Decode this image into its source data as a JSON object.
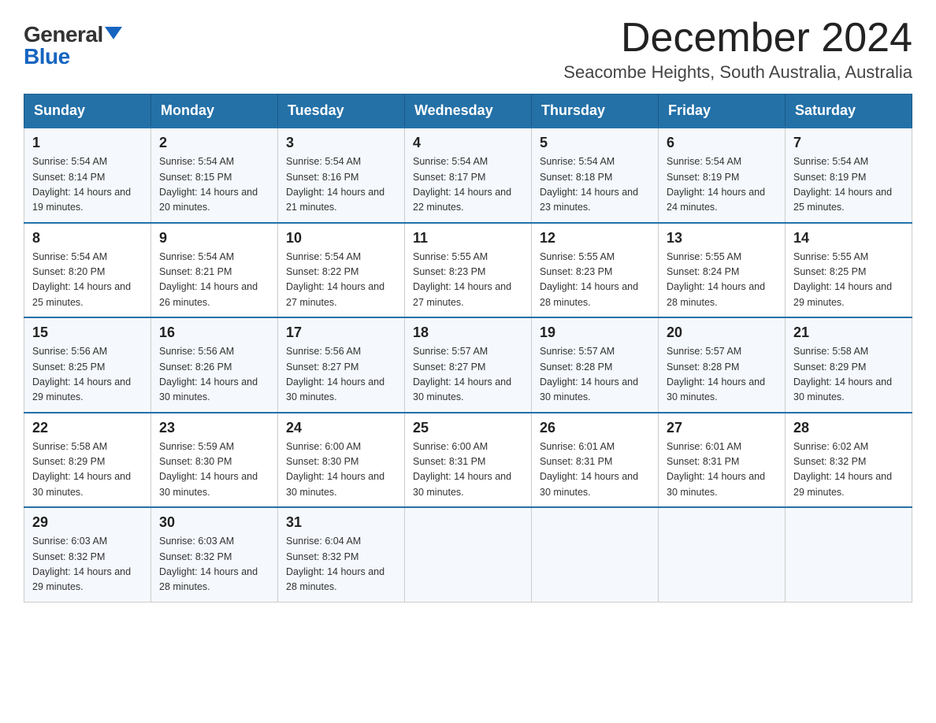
{
  "logo": {
    "general": "General",
    "blue": "Blue"
  },
  "title": {
    "month_year": "December 2024",
    "location": "Seacombe Heights, South Australia, Australia"
  },
  "headers": [
    "Sunday",
    "Monday",
    "Tuesday",
    "Wednesday",
    "Thursday",
    "Friday",
    "Saturday"
  ],
  "weeks": [
    [
      {
        "day": "1",
        "sunrise": "5:54 AM",
        "sunset": "8:14 PM",
        "daylight": "14 hours and 19 minutes."
      },
      {
        "day": "2",
        "sunrise": "5:54 AM",
        "sunset": "8:15 PM",
        "daylight": "14 hours and 20 minutes."
      },
      {
        "day": "3",
        "sunrise": "5:54 AM",
        "sunset": "8:16 PM",
        "daylight": "14 hours and 21 minutes."
      },
      {
        "day": "4",
        "sunrise": "5:54 AM",
        "sunset": "8:17 PM",
        "daylight": "14 hours and 22 minutes."
      },
      {
        "day": "5",
        "sunrise": "5:54 AM",
        "sunset": "8:18 PM",
        "daylight": "14 hours and 23 minutes."
      },
      {
        "day": "6",
        "sunrise": "5:54 AM",
        "sunset": "8:19 PM",
        "daylight": "14 hours and 24 minutes."
      },
      {
        "day": "7",
        "sunrise": "5:54 AM",
        "sunset": "8:19 PM",
        "daylight": "14 hours and 25 minutes."
      }
    ],
    [
      {
        "day": "8",
        "sunrise": "5:54 AM",
        "sunset": "8:20 PM",
        "daylight": "14 hours and 25 minutes."
      },
      {
        "day": "9",
        "sunrise": "5:54 AM",
        "sunset": "8:21 PM",
        "daylight": "14 hours and 26 minutes."
      },
      {
        "day": "10",
        "sunrise": "5:54 AM",
        "sunset": "8:22 PM",
        "daylight": "14 hours and 27 minutes."
      },
      {
        "day": "11",
        "sunrise": "5:55 AM",
        "sunset": "8:23 PM",
        "daylight": "14 hours and 27 minutes."
      },
      {
        "day": "12",
        "sunrise": "5:55 AM",
        "sunset": "8:23 PM",
        "daylight": "14 hours and 28 minutes."
      },
      {
        "day": "13",
        "sunrise": "5:55 AM",
        "sunset": "8:24 PM",
        "daylight": "14 hours and 28 minutes."
      },
      {
        "day": "14",
        "sunrise": "5:55 AM",
        "sunset": "8:25 PM",
        "daylight": "14 hours and 29 minutes."
      }
    ],
    [
      {
        "day": "15",
        "sunrise": "5:56 AM",
        "sunset": "8:25 PM",
        "daylight": "14 hours and 29 minutes."
      },
      {
        "day": "16",
        "sunrise": "5:56 AM",
        "sunset": "8:26 PM",
        "daylight": "14 hours and 30 minutes."
      },
      {
        "day": "17",
        "sunrise": "5:56 AM",
        "sunset": "8:27 PM",
        "daylight": "14 hours and 30 minutes."
      },
      {
        "day": "18",
        "sunrise": "5:57 AM",
        "sunset": "8:27 PM",
        "daylight": "14 hours and 30 minutes."
      },
      {
        "day": "19",
        "sunrise": "5:57 AM",
        "sunset": "8:28 PM",
        "daylight": "14 hours and 30 minutes."
      },
      {
        "day": "20",
        "sunrise": "5:57 AM",
        "sunset": "8:28 PM",
        "daylight": "14 hours and 30 minutes."
      },
      {
        "day": "21",
        "sunrise": "5:58 AM",
        "sunset": "8:29 PM",
        "daylight": "14 hours and 30 minutes."
      }
    ],
    [
      {
        "day": "22",
        "sunrise": "5:58 AM",
        "sunset": "8:29 PM",
        "daylight": "14 hours and 30 minutes."
      },
      {
        "day": "23",
        "sunrise": "5:59 AM",
        "sunset": "8:30 PM",
        "daylight": "14 hours and 30 minutes."
      },
      {
        "day": "24",
        "sunrise": "6:00 AM",
        "sunset": "8:30 PM",
        "daylight": "14 hours and 30 minutes."
      },
      {
        "day": "25",
        "sunrise": "6:00 AM",
        "sunset": "8:31 PM",
        "daylight": "14 hours and 30 minutes."
      },
      {
        "day": "26",
        "sunrise": "6:01 AM",
        "sunset": "8:31 PM",
        "daylight": "14 hours and 30 minutes."
      },
      {
        "day": "27",
        "sunrise": "6:01 AM",
        "sunset": "8:31 PM",
        "daylight": "14 hours and 30 minutes."
      },
      {
        "day": "28",
        "sunrise": "6:02 AM",
        "sunset": "8:32 PM",
        "daylight": "14 hours and 29 minutes."
      }
    ],
    [
      {
        "day": "29",
        "sunrise": "6:03 AM",
        "sunset": "8:32 PM",
        "daylight": "14 hours and 29 minutes."
      },
      {
        "day": "30",
        "sunrise": "6:03 AM",
        "sunset": "8:32 PM",
        "daylight": "14 hours and 28 minutes."
      },
      {
        "day": "31",
        "sunrise": "6:04 AM",
        "sunset": "8:32 PM",
        "daylight": "14 hours and 28 minutes."
      },
      null,
      null,
      null,
      null
    ]
  ]
}
